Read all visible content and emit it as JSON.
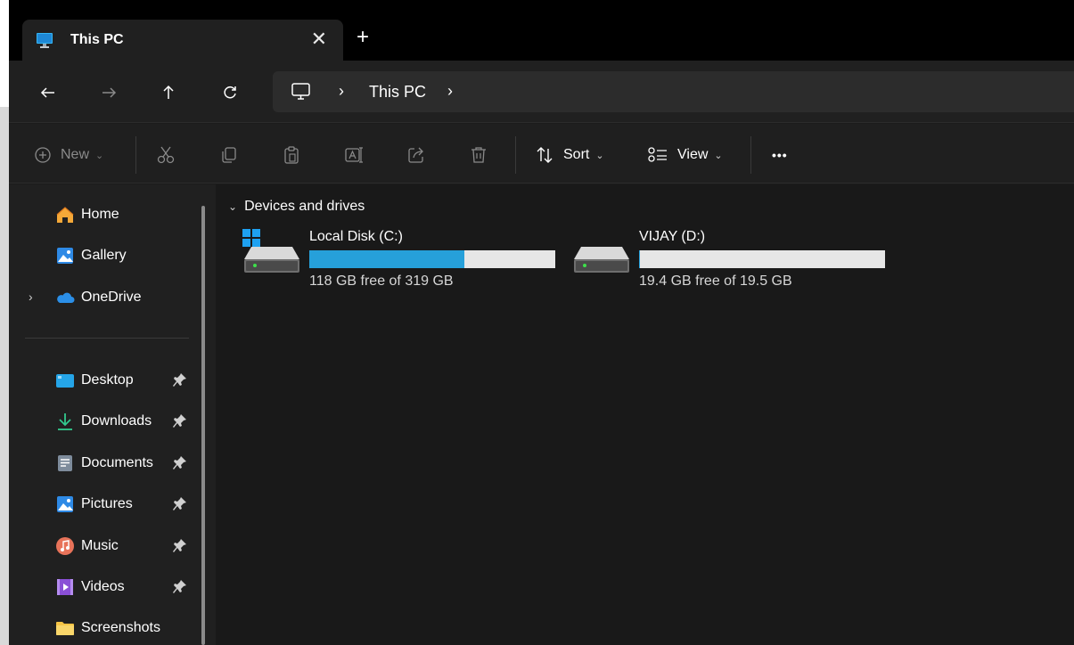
{
  "tab": {
    "title": "This PC",
    "close": "✕",
    "new": "+"
  },
  "address": {
    "segment": "This PC",
    "separator": "›"
  },
  "toolbar": {
    "new_label": "New",
    "sort_label": "Sort",
    "view_label": "View",
    "more_label": "•••"
  },
  "sidebar": {
    "items": [
      {
        "label": "Home",
        "icon": "home-icon"
      },
      {
        "label": "Gallery",
        "icon": "gallery-icon"
      },
      {
        "label": "OneDrive",
        "icon": "cloud-icon"
      },
      {
        "label": "Desktop",
        "icon": "desktop-folder-icon",
        "pinned": true
      },
      {
        "label": "Downloads",
        "icon": "download-icon",
        "pinned": true
      },
      {
        "label": "Documents",
        "icon": "documents-icon",
        "pinned": true
      },
      {
        "label": "Pictures",
        "icon": "pictures-icon",
        "pinned": true
      },
      {
        "label": "Music",
        "icon": "music-icon",
        "pinned": true
      },
      {
        "label": "Videos",
        "icon": "videos-icon",
        "pinned": true
      },
      {
        "label": "Screenshots",
        "icon": "folder-icon"
      }
    ]
  },
  "content": {
    "group_label": "Devices and drives",
    "drives": [
      {
        "name": "Local Disk (C:)",
        "free_text": "118 GB free of 319 GB",
        "used_fraction": 0.63,
        "icon": "windows-drive-icon"
      },
      {
        "name": "VIJAY (D:)",
        "free_text": "19.4 GB free of 19.5 GB",
        "used_fraction": 0.005,
        "icon": "drive-icon"
      }
    ]
  },
  "colors": {
    "accent": "#26a0da",
    "bar_bg": "#e6e6e6",
    "window_bg": "#191919",
    "sidebar_bg": "#202020"
  }
}
